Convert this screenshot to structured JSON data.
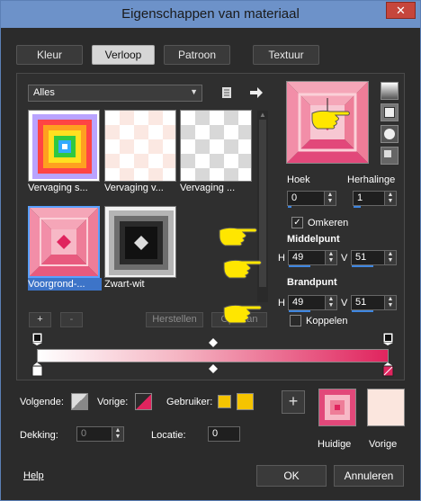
{
  "window": {
    "title": "Eigenschappen van materiaal",
    "close_glyph": "✕"
  },
  "tabs": [
    {
      "label": "Kleur",
      "active": false
    },
    {
      "label": "Verloop",
      "active": true
    },
    {
      "label": "Patroon",
      "active": false
    },
    {
      "label": "Textuur",
      "active": false
    }
  ],
  "library": {
    "category": "Alles",
    "items": [
      {
        "label": "Vervaging s..."
      },
      {
        "label": "Vervaging v..."
      },
      {
        "label": "Vervaging ..."
      },
      {
        "label": "Voorgrond-...",
        "selected": true
      },
      {
        "label": "Zwart-wit"
      }
    ],
    "add_label": "+",
    "remove_label": "-",
    "reset_label": "Herstellen",
    "save_label": "Opslaan"
  },
  "settings": {
    "angle_label": "Hoek",
    "angle_value": "0",
    "repeat_label": "Herhalinge",
    "repeat_value": "1",
    "invert_label": "Omkeren",
    "invert_checked": true,
    "center_label": "Middelpunt",
    "center_h": "49",
    "center_v": "51",
    "focal_label": "Brandpunt",
    "focal_h": "49",
    "focal_v": "51",
    "link_label": "Koppelen",
    "link_checked": false,
    "h_label": "H",
    "v_label": "V"
  },
  "gradient_bar": {
    "start_color": "#ffffff",
    "end_color": "#e0245e"
  },
  "stop_settings": {
    "next_label": "Volgende:",
    "prev_label": "Vorige:",
    "user_label": "Gebruiker:",
    "opacity_label": "Dekking:",
    "opacity_value": "0",
    "location_label": "Locatie:",
    "location_value": "0",
    "user_color_1": "#f5c400",
    "user_color_2": "#f5c400"
  },
  "preview": {
    "current_label": "Huidige",
    "previous_label": "Vorige",
    "add_glyph": "+"
  },
  "footer": {
    "help_label": "Help",
    "ok_label": "OK",
    "cancel_label": "Annuleren"
  },
  "colors": {
    "accent": "#3e86e0",
    "foreground": "#e0245e",
    "background": "#fbe6de"
  }
}
